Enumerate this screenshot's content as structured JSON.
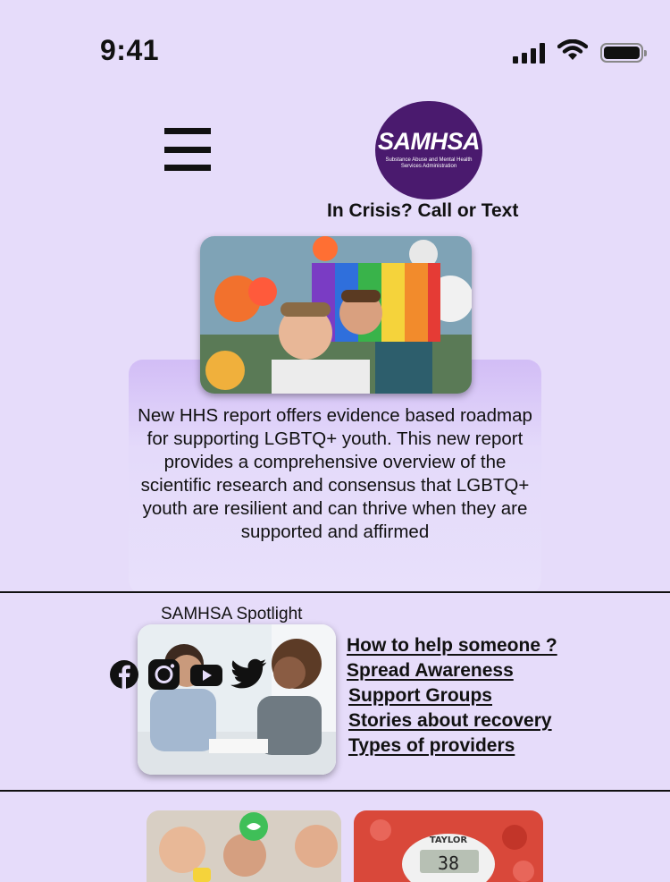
{
  "status_bar": {
    "time": "9:41"
  },
  "header": {
    "logo_text": "SAMHSA",
    "logo_subtitle": "Substance Abuse and Mental Health Services Administration",
    "crisis_label": "In Crisis? Call or Text"
  },
  "feature": {
    "description": "New HHS report offers evidence based roadmap for supporting LGBTQ+ youth. This new report provides a comprehensive overview of the scientific research and consensus that LGBTQ+ youth are resilient and can thrive when they are supported and affirmed"
  },
  "spotlight": {
    "title": "SAMHSA Spotlight",
    "social_icons": [
      "facebook-icon",
      "instagram-icon",
      "youtube-icon",
      "twitter-icon"
    ],
    "links": [
      "How to help someone ?",
      "Spread Awareness",
      "Support Groups",
      "Stories about recovery",
      "Types of providers"
    ]
  },
  "colors": {
    "background": "#e6dcfa",
    "logo": "#4a1a6e",
    "card_gradient_top": "#d2bdf6"
  }
}
